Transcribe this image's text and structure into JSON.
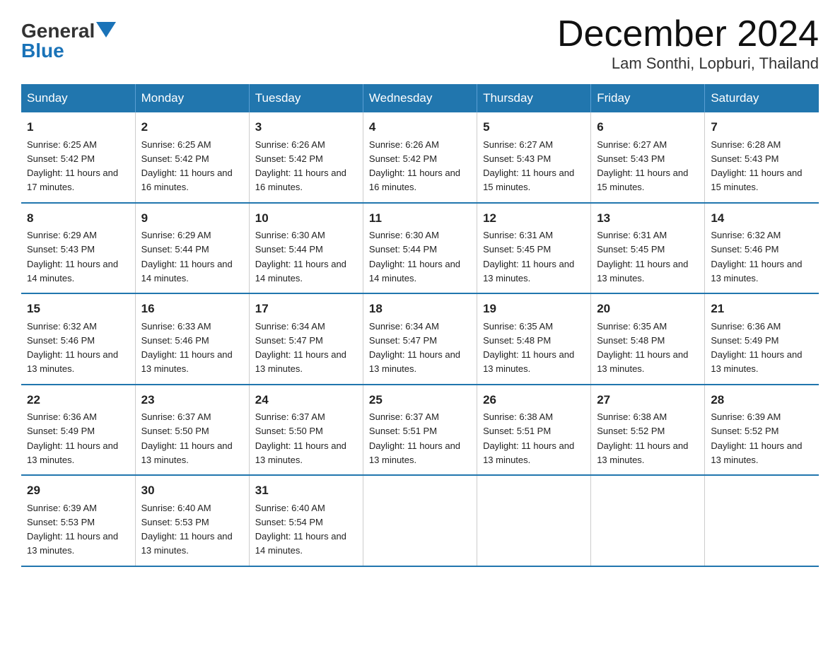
{
  "logo": {
    "general": "General",
    "arrow": "▶",
    "blue": "Blue"
  },
  "title": "December 2024",
  "location": "Lam Sonthi, Lopburi, Thailand",
  "days_of_week": [
    "Sunday",
    "Monday",
    "Tuesday",
    "Wednesday",
    "Thursday",
    "Friday",
    "Saturday"
  ],
  "weeks": [
    [
      {
        "day": "1",
        "sunrise": "6:25 AM",
        "sunset": "5:42 PM",
        "daylight": "11 hours and 17 minutes."
      },
      {
        "day": "2",
        "sunrise": "6:25 AM",
        "sunset": "5:42 PM",
        "daylight": "11 hours and 16 minutes."
      },
      {
        "day": "3",
        "sunrise": "6:26 AM",
        "sunset": "5:42 PM",
        "daylight": "11 hours and 16 minutes."
      },
      {
        "day": "4",
        "sunrise": "6:26 AM",
        "sunset": "5:42 PM",
        "daylight": "11 hours and 16 minutes."
      },
      {
        "day": "5",
        "sunrise": "6:27 AM",
        "sunset": "5:43 PM",
        "daylight": "11 hours and 15 minutes."
      },
      {
        "day": "6",
        "sunrise": "6:27 AM",
        "sunset": "5:43 PM",
        "daylight": "11 hours and 15 minutes."
      },
      {
        "day": "7",
        "sunrise": "6:28 AM",
        "sunset": "5:43 PM",
        "daylight": "11 hours and 15 minutes."
      }
    ],
    [
      {
        "day": "8",
        "sunrise": "6:29 AM",
        "sunset": "5:43 PM",
        "daylight": "11 hours and 14 minutes."
      },
      {
        "day": "9",
        "sunrise": "6:29 AM",
        "sunset": "5:44 PM",
        "daylight": "11 hours and 14 minutes."
      },
      {
        "day": "10",
        "sunrise": "6:30 AM",
        "sunset": "5:44 PM",
        "daylight": "11 hours and 14 minutes."
      },
      {
        "day": "11",
        "sunrise": "6:30 AM",
        "sunset": "5:44 PM",
        "daylight": "11 hours and 14 minutes."
      },
      {
        "day": "12",
        "sunrise": "6:31 AM",
        "sunset": "5:45 PM",
        "daylight": "11 hours and 13 minutes."
      },
      {
        "day": "13",
        "sunrise": "6:31 AM",
        "sunset": "5:45 PM",
        "daylight": "11 hours and 13 minutes."
      },
      {
        "day": "14",
        "sunrise": "6:32 AM",
        "sunset": "5:46 PM",
        "daylight": "11 hours and 13 minutes."
      }
    ],
    [
      {
        "day": "15",
        "sunrise": "6:32 AM",
        "sunset": "5:46 PM",
        "daylight": "11 hours and 13 minutes."
      },
      {
        "day": "16",
        "sunrise": "6:33 AM",
        "sunset": "5:46 PM",
        "daylight": "11 hours and 13 minutes."
      },
      {
        "day": "17",
        "sunrise": "6:34 AM",
        "sunset": "5:47 PM",
        "daylight": "11 hours and 13 minutes."
      },
      {
        "day": "18",
        "sunrise": "6:34 AM",
        "sunset": "5:47 PM",
        "daylight": "11 hours and 13 minutes."
      },
      {
        "day": "19",
        "sunrise": "6:35 AM",
        "sunset": "5:48 PM",
        "daylight": "11 hours and 13 minutes."
      },
      {
        "day": "20",
        "sunrise": "6:35 AM",
        "sunset": "5:48 PM",
        "daylight": "11 hours and 13 minutes."
      },
      {
        "day": "21",
        "sunrise": "6:36 AM",
        "sunset": "5:49 PM",
        "daylight": "11 hours and 13 minutes."
      }
    ],
    [
      {
        "day": "22",
        "sunrise": "6:36 AM",
        "sunset": "5:49 PM",
        "daylight": "11 hours and 13 minutes."
      },
      {
        "day": "23",
        "sunrise": "6:37 AM",
        "sunset": "5:50 PM",
        "daylight": "11 hours and 13 minutes."
      },
      {
        "day": "24",
        "sunrise": "6:37 AM",
        "sunset": "5:50 PM",
        "daylight": "11 hours and 13 minutes."
      },
      {
        "day": "25",
        "sunrise": "6:37 AM",
        "sunset": "5:51 PM",
        "daylight": "11 hours and 13 minutes."
      },
      {
        "day": "26",
        "sunrise": "6:38 AM",
        "sunset": "5:51 PM",
        "daylight": "11 hours and 13 minutes."
      },
      {
        "day": "27",
        "sunrise": "6:38 AM",
        "sunset": "5:52 PM",
        "daylight": "11 hours and 13 minutes."
      },
      {
        "day": "28",
        "sunrise": "6:39 AM",
        "sunset": "5:52 PM",
        "daylight": "11 hours and 13 minutes."
      }
    ],
    [
      {
        "day": "29",
        "sunrise": "6:39 AM",
        "sunset": "5:53 PM",
        "daylight": "11 hours and 13 minutes."
      },
      {
        "day": "30",
        "sunrise": "6:40 AM",
        "sunset": "5:53 PM",
        "daylight": "11 hours and 13 minutes."
      },
      {
        "day": "31",
        "sunrise": "6:40 AM",
        "sunset": "5:54 PM",
        "daylight": "11 hours and 14 minutes."
      },
      null,
      null,
      null,
      null
    ]
  ]
}
